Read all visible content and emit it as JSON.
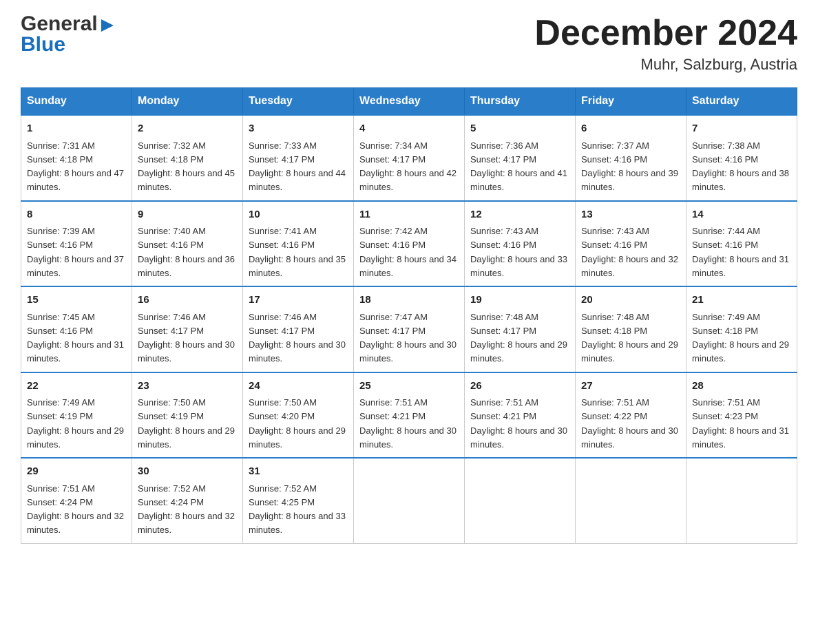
{
  "logo": {
    "line1": "General",
    "line2": "Blue"
  },
  "header": {
    "month_year": "December 2024",
    "location": "Muhr, Salzburg, Austria"
  },
  "days_of_week": [
    "Sunday",
    "Monday",
    "Tuesday",
    "Wednesday",
    "Thursday",
    "Friday",
    "Saturday"
  ],
  "weeks": [
    [
      {
        "day": "1",
        "sunrise": "7:31 AM",
        "sunset": "4:18 PM",
        "daylight": "8 hours and 47 minutes."
      },
      {
        "day": "2",
        "sunrise": "7:32 AM",
        "sunset": "4:18 PM",
        "daylight": "8 hours and 45 minutes."
      },
      {
        "day": "3",
        "sunrise": "7:33 AM",
        "sunset": "4:17 PM",
        "daylight": "8 hours and 44 minutes."
      },
      {
        "day": "4",
        "sunrise": "7:34 AM",
        "sunset": "4:17 PM",
        "daylight": "8 hours and 42 minutes."
      },
      {
        "day": "5",
        "sunrise": "7:36 AM",
        "sunset": "4:17 PM",
        "daylight": "8 hours and 41 minutes."
      },
      {
        "day": "6",
        "sunrise": "7:37 AM",
        "sunset": "4:16 PM",
        "daylight": "8 hours and 39 minutes."
      },
      {
        "day": "7",
        "sunrise": "7:38 AM",
        "sunset": "4:16 PM",
        "daylight": "8 hours and 38 minutes."
      }
    ],
    [
      {
        "day": "8",
        "sunrise": "7:39 AM",
        "sunset": "4:16 PM",
        "daylight": "8 hours and 37 minutes."
      },
      {
        "day": "9",
        "sunrise": "7:40 AM",
        "sunset": "4:16 PM",
        "daylight": "8 hours and 36 minutes."
      },
      {
        "day": "10",
        "sunrise": "7:41 AM",
        "sunset": "4:16 PM",
        "daylight": "8 hours and 35 minutes."
      },
      {
        "day": "11",
        "sunrise": "7:42 AM",
        "sunset": "4:16 PM",
        "daylight": "8 hours and 34 minutes."
      },
      {
        "day": "12",
        "sunrise": "7:43 AM",
        "sunset": "4:16 PM",
        "daylight": "8 hours and 33 minutes."
      },
      {
        "day": "13",
        "sunrise": "7:43 AM",
        "sunset": "4:16 PM",
        "daylight": "8 hours and 32 minutes."
      },
      {
        "day": "14",
        "sunrise": "7:44 AM",
        "sunset": "4:16 PM",
        "daylight": "8 hours and 31 minutes."
      }
    ],
    [
      {
        "day": "15",
        "sunrise": "7:45 AM",
        "sunset": "4:16 PM",
        "daylight": "8 hours and 31 minutes."
      },
      {
        "day": "16",
        "sunrise": "7:46 AM",
        "sunset": "4:17 PM",
        "daylight": "8 hours and 30 minutes."
      },
      {
        "day": "17",
        "sunrise": "7:46 AM",
        "sunset": "4:17 PM",
        "daylight": "8 hours and 30 minutes."
      },
      {
        "day": "18",
        "sunrise": "7:47 AM",
        "sunset": "4:17 PM",
        "daylight": "8 hours and 30 minutes."
      },
      {
        "day": "19",
        "sunrise": "7:48 AM",
        "sunset": "4:17 PM",
        "daylight": "8 hours and 29 minutes."
      },
      {
        "day": "20",
        "sunrise": "7:48 AM",
        "sunset": "4:18 PM",
        "daylight": "8 hours and 29 minutes."
      },
      {
        "day": "21",
        "sunrise": "7:49 AM",
        "sunset": "4:18 PM",
        "daylight": "8 hours and 29 minutes."
      }
    ],
    [
      {
        "day": "22",
        "sunrise": "7:49 AM",
        "sunset": "4:19 PM",
        "daylight": "8 hours and 29 minutes."
      },
      {
        "day": "23",
        "sunrise": "7:50 AM",
        "sunset": "4:19 PM",
        "daylight": "8 hours and 29 minutes."
      },
      {
        "day": "24",
        "sunrise": "7:50 AM",
        "sunset": "4:20 PM",
        "daylight": "8 hours and 29 minutes."
      },
      {
        "day": "25",
        "sunrise": "7:51 AM",
        "sunset": "4:21 PM",
        "daylight": "8 hours and 30 minutes."
      },
      {
        "day": "26",
        "sunrise": "7:51 AM",
        "sunset": "4:21 PM",
        "daylight": "8 hours and 30 minutes."
      },
      {
        "day": "27",
        "sunrise": "7:51 AM",
        "sunset": "4:22 PM",
        "daylight": "8 hours and 30 minutes."
      },
      {
        "day": "28",
        "sunrise": "7:51 AM",
        "sunset": "4:23 PM",
        "daylight": "8 hours and 31 minutes."
      }
    ],
    [
      {
        "day": "29",
        "sunrise": "7:51 AM",
        "sunset": "4:24 PM",
        "daylight": "8 hours and 32 minutes."
      },
      {
        "day": "30",
        "sunrise": "7:52 AM",
        "sunset": "4:24 PM",
        "daylight": "8 hours and 32 minutes."
      },
      {
        "day": "31",
        "sunrise": "7:52 AM",
        "sunset": "4:25 PM",
        "daylight": "8 hours and 33 minutes."
      },
      null,
      null,
      null,
      null
    ]
  ],
  "labels": {
    "sunrise": "Sunrise:",
    "sunset": "Sunset:",
    "daylight": "Daylight:"
  }
}
